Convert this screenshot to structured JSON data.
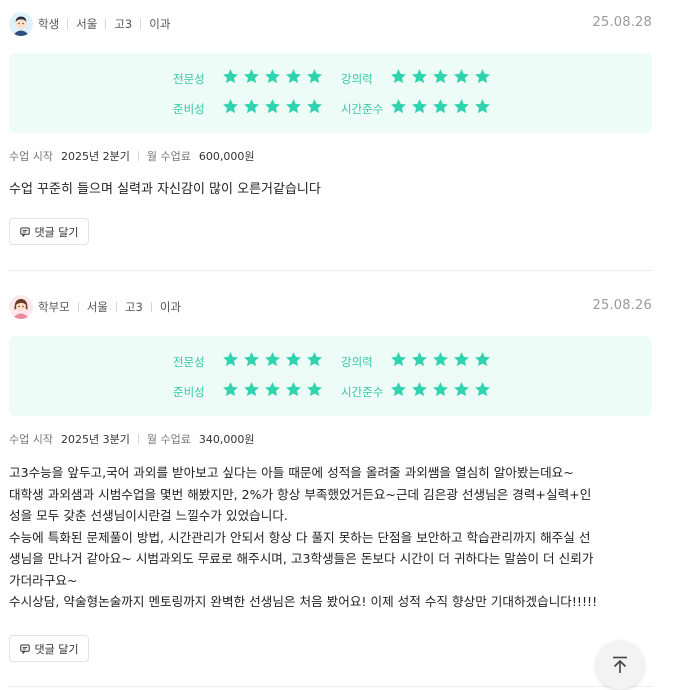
{
  "reviews": [
    {
      "author": "학생",
      "region": "서울",
      "grade": "고3",
      "track": "이과",
      "date": "25.08.28",
      "avatar_icon": "student-avatar-icon",
      "ratings": [
        {
          "label": "전문성",
          "stars": 5
        },
        {
          "label": "강의력",
          "stars": 5
        },
        {
          "label": "준비성",
          "stars": 5
        },
        {
          "label": "시간준수",
          "stars": 5
        }
      ],
      "start_label": "수업 시작",
      "start_value": "2025년 2분기",
      "fee_label": "월 수업료",
      "fee_value": "600,000원",
      "lines": [
        "수업 꾸준히 들으며 실력과 자신감이 많이 오른거같습니다"
      ],
      "reply_label": "댓글 달기"
    },
    {
      "author": "학부모",
      "region": "서울",
      "grade": "고3",
      "track": "이과",
      "date": "25.08.26",
      "avatar_icon": "parent-avatar-icon",
      "ratings": [
        {
          "label": "전문성",
          "stars": 5
        },
        {
          "label": "강의력",
          "stars": 5
        },
        {
          "label": "준비성",
          "stars": 5
        },
        {
          "label": "시간준수",
          "stars": 5
        }
      ],
      "start_label": "수업 시작",
      "start_value": "2025년 3분기",
      "fee_label": "월 수업료",
      "fee_value": "340,000원",
      "lines": [
        "고3수능을 앞두고,국어 과외를 받아보고 싶다는 아들 때문에 성적을 올려줄 과외쌤을 열심히 알아봤는데요~",
        "대학생 과외샘과 시범수업을 몇번 해봤지만, 2%가 항상 부족했었거든요~근데 김은광 선생님은 경력+실력+인",
        "성을 모두 갖춘 선생님이시란걸 느낄수가 있었습니다.",
        "수능에 특화된 문제풀이 방법, 시간관리가 안되서 항상 다 풀지 못하는 단점을 보안하고 학습관리까지 해주실 선",
        "생님을 만나거 같아요~ 시범과외도 무료로 해주시며, 고3학생들은 돈보다 시간이 더 귀하다는 말씀이 더 신뢰가",
        "가더라구요~",
        "수시상담, 약술형논술까지 멘토링까지 완벽한 선생님은 처음 봤어요! 이제 성적 수직 향상만 기대하겠습니다!!!!!"
      ],
      "reply_label": "댓글 달기"
    }
  ],
  "scroll_top_icon": "arrow-up-icon",
  "colors": {
    "accent": "#35c7a5",
    "star": "#2fd3ad",
    "panel": "#eefcf8"
  }
}
